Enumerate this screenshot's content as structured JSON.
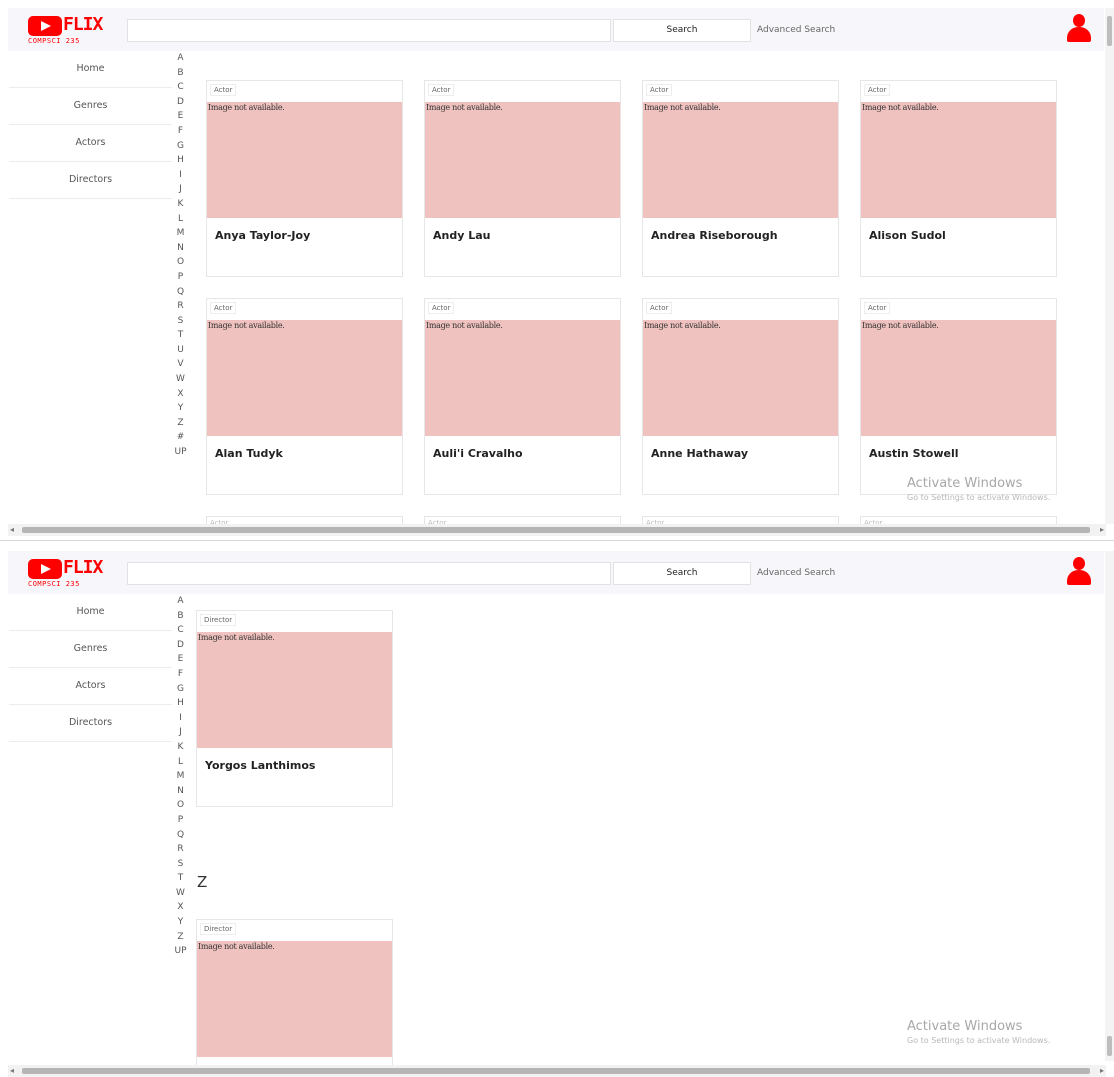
{
  "brand": {
    "logo_text": "FLIX",
    "logo_sub": "COMPSCI 235",
    "accent": "#ff0000"
  },
  "header": {
    "search_label": "Search",
    "advanced_label": "Advanced Search"
  },
  "sidebar": {
    "items": [
      {
        "label": "Home"
      },
      {
        "label": "Genres"
      },
      {
        "label": "Actors"
      },
      {
        "label": "Directors"
      }
    ]
  },
  "alphabet": [
    "A",
    "B",
    "C",
    "D",
    "E",
    "F",
    "G",
    "H",
    "I",
    "J",
    "K",
    "L",
    "M",
    "N",
    "O",
    "P",
    "Q",
    "R",
    "S",
    "T",
    "U",
    "V",
    "W",
    "X",
    "Y",
    "Z",
    "#",
    "UP"
  ],
  "alphabet2": [
    "A",
    "B",
    "C",
    "D",
    "E",
    "F",
    "G",
    "H",
    "I",
    "J",
    "K",
    "L",
    "M",
    "N",
    "O",
    "P",
    "Q",
    "R",
    "S",
    "T",
    "W",
    "X",
    "Y",
    "Z",
    "UP"
  ],
  "image_alt": "Image not available.",
  "actors": [
    {
      "type": "Actor",
      "name": "Anya Taylor-Joy"
    },
    {
      "type": "Actor",
      "name": "Andy Lau"
    },
    {
      "type": "Actor",
      "name": "Andrea Riseborough"
    },
    {
      "type": "Actor",
      "name": "Alison Sudol"
    },
    {
      "type": "Actor",
      "name": "Alan Tudyk"
    },
    {
      "type": "Actor",
      "name": "Auli'i Cravalho"
    },
    {
      "type": "Actor",
      "name": "Anne Hathaway"
    },
    {
      "type": "Actor",
      "name": "Austin Stowell"
    }
  ],
  "stub_label": "Actor",
  "directors": [
    {
      "type": "Director",
      "name": "Yorgos Lanthimos"
    },
    {
      "type": "Director",
      "name": ""
    }
  ],
  "section_letter": "Z",
  "watermark": {
    "title": "Activate Windows",
    "subtitle": "Go to Settings to activate Windows."
  }
}
